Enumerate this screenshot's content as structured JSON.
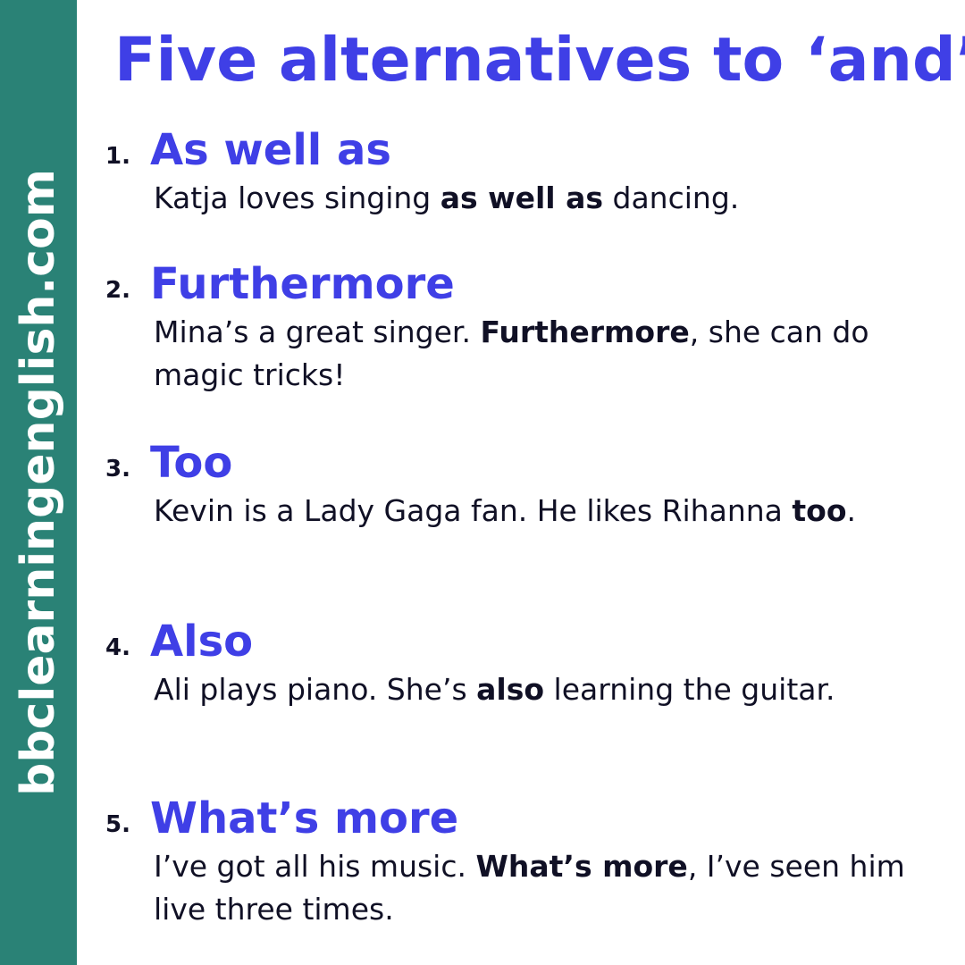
{
  "brand": {
    "site": "bbclearningenglish.com",
    "accent_color": "#2a8276"
  },
  "title": "Five alternatives to ‘and’",
  "colors": {
    "heading": "#3f3fe6",
    "text": "#101025"
  },
  "items": [
    {
      "number": "1.",
      "heading": "As well as",
      "example": {
        "before": "Katja loves singing ",
        "bold": "as well as",
        "after": " dancing."
      }
    },
    {
      "number": "2.",
      "heading": "Furthermore",
      "example": {
        "before": "Mina’s a great singer. ",
        "bold": "Furthermore",
        "after": ", she can do magic tricks!"
      }
    },
    {
      "number": "3.",
      "heading": "Too",
      "example": {
        "before": "Kevin is a Lady Gaga fan. He likes Rihanna ",
        "bold": "too",
        "after": "."
      }
    },
    {
      "number": "4.",
      "heading": "Also",
      "example": {
        "before": "Ali plays piano. She’s ",
        "bold": "also",
        "after": " learning the guitar."
      }
    },
    {
      "number": "5.",
      "heading": "What’s more",
      "example": {
        "before": "I’ve got all his music. ",
        "bold": "What’s more",
        "after": ", I’ve seen him live three times."
      }
    }
  ]
}
